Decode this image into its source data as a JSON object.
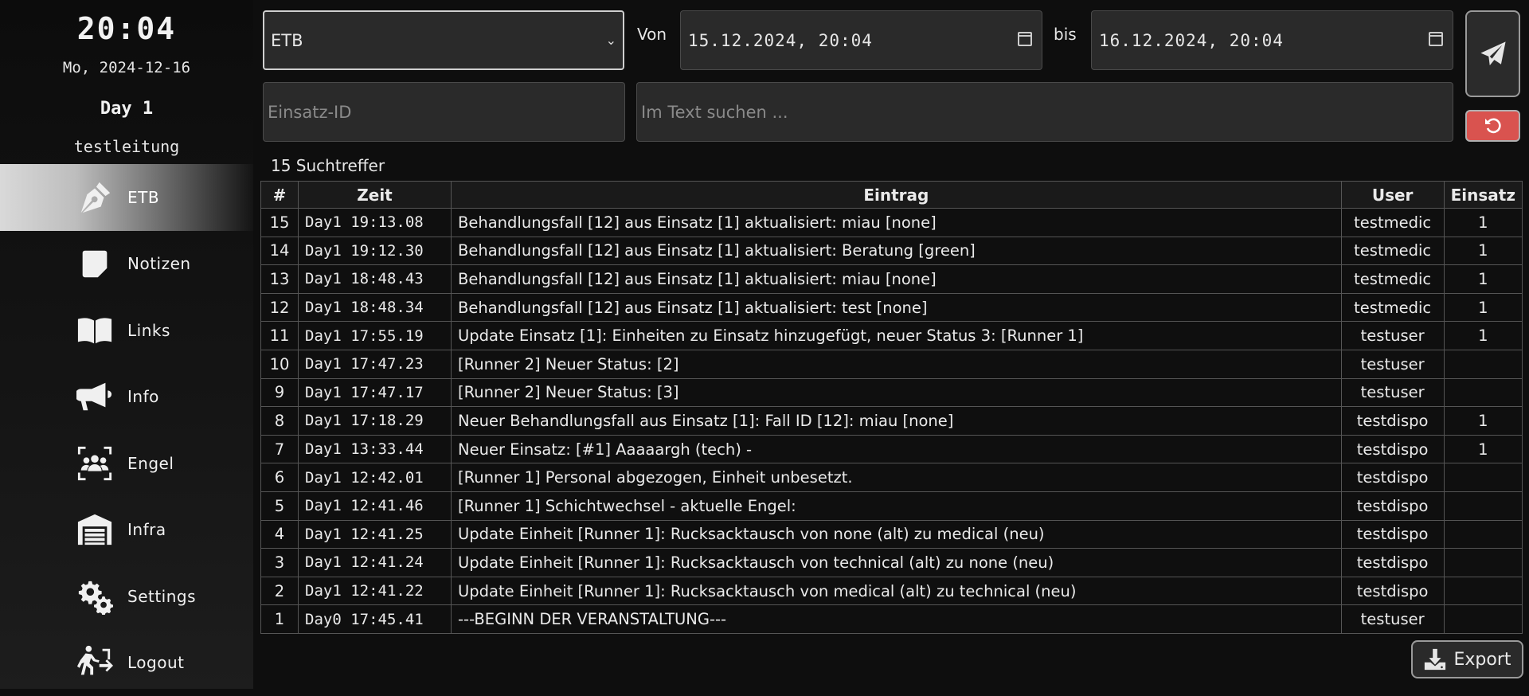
{
  "sidebar": {
    "clock": "20:04",
    "date": "Mo, 2024-12-16",
    "day": "Day 1",
    "user": "testleitung",
    "items": [
      {
        "label": "ETB",
        "icon": "pen-nib-icon",
        "active": true
      },
      {
        "label": "Notizen",
        "icon": "sticky-note-icon"
      },
      {
        "label": "Links",
        "icon": "book-icon"
      },
      {
        "label": "Info",
        "icon": "megaphone-icon"
      },
      {
        "label": "Engel",
        "icon": "people-icon"
      },
      {
        "label": "Infra",
        "icon": "warehouse-icon"
      },
      {
        "label": "Settings",
        "icon": "gears-icon"
      },
      {
        "label": "Logout",
        "icon": "exit-person-icon"
      }
    ]
  },
  "filters": {
    "type_select": "ETB",
    "from_label": "Von",
    "from_value": "15.12.2024, 20:04",
    "to_label": "bis",
    "to_value": "16.12.2024, 20:04",
    "einsatz_placeholder": "Einsatz-ID",
    "search_placeholder": "Im Text suchen ..."
  },
  "results": {
    "count_text": "15 Suchtreffer",
    "headers": {
      "num": "#",
      "time": "Zeit",
      "entry": "Eintrag",
      "user": "User",
      "einsatz": "Einsatz"
    },
    "rows": [
      {
        "num": "15",
        "time": "Day1 19:13.08",
        "entry": "Behandlungsfall [12] aus Einsatz [1] aktualisiert: miau [none]",
        "user": "testmedic",
        "einsatz": "1"
      },
      {
        "num": "14",
        "time": "Day1 19:12.30",
        "entry": "Behandlungsfall [12] aus Einsatz [1] aktualisiert: Beratung [green]",
        "user": "testmedic",
        "einsatz": "1"
      },
      {
        "num": "13",
        "time": "Day1 18:48.43",
        "entry": "Behandlungsfall [12] aus Einsatz [1] aktualisiert: miau [none]",
        "user": "testmedic",
        "einsatz": "1"
      },
      {
        "num": "12",
        "time": "Day1 18:48.34",
        "entry": "Behandlungsfall [12] aus Einsatz [1] aktualisiert: test [none]",
        "user": "testmedic",
        "einsatz": "1"
      },
      {
        "num": "11",
        "time": "Day1 17:55.19",
        "entry": "Update Einsatz [1]: Einheiten zu Einsatz hinzugefügt, neuer Status 3: [Runner 1]",
        "user": "testuser",
        "einsatz": "1"
      },
      {
        "num": "10",
        "time": "Day1 17:47.23",
        "entry": "[Runner 2] Neuer Status: [2]",
        "user": "testuser",
        "einsatz": ""
      },
      {
        "num": "9",
        "time": "Day1 17:47.17",
        "entry": "[Runner 2] Neuer Status: [3]",
        "user": "testuser",
        "einsatz": ""
      },
      {
        "num": "8",
        "time": "Day1 17:18.29",
        "entry": "Neuer Behandlungsfall aus Einsatz [1]: Fall ID [12]: miau [none]",
        "user": "testdispo",
        "einsatz": "1"
      },
      {
        "num": "7",
        "time": "Day1 13:33.44",
        "entry": "Neuer Einsatz: [#1] Aaaaargh (tech) -",
        "user": "testdispo",
        "einsatz": "1"
      },
      {
        "num": "6",
        "time": "Day1 12:42.01",
        "entry": "[Runner 1] Personal abgezogen, Einheit unbesetzt.",
        "user": "testdispo",
        "einsatz": ""
      },
      {
        "num": "5",
        "time": "Day1 12:41.46",
        "entry": "[Runner 1] Schichtwechsel - aktuelle Engel:",
        "user": "testdispo",
        "einsatz": ""
      },
      {
        "num": "4",
        "time": "Day1 12:41.25",
        "entry": "Update Einheit [Runner 1]: Rucksacktausch von none (alt) zu medical (neu)",
        "user": "testdispo",
        "einsatz": ""
      },
      {
        "num": "3",
        "time": "Day1 12:41.24",
        "entry": "Update Einheit [Runner 1]: Rucksacktausch von technical (alt) zu none (neu)",
        "user": "testdispo",
        "einsatz": ""
      },
      {
        "num": "2",
        "time": "Day1 12:41.22",
        "entry": "Update Einheit [Runner 1]: Rucksacktausch von medical (alt) zu technical (neu)",
        "user": "testdispo",
        "einsatz": ""
      },
      {
        "num": "1",
        "time": "Day0 17:45.41",
        "entry": "---BEGINN DER VERANSTALTUNG---",
        "user": "testuser",
        "einsatz": ""
      }
    ]
  },
  "export_label": "Export",
  "colors": {
    "reset": "#d9534f",
    "background": "#0e0e0e"
  }
}
